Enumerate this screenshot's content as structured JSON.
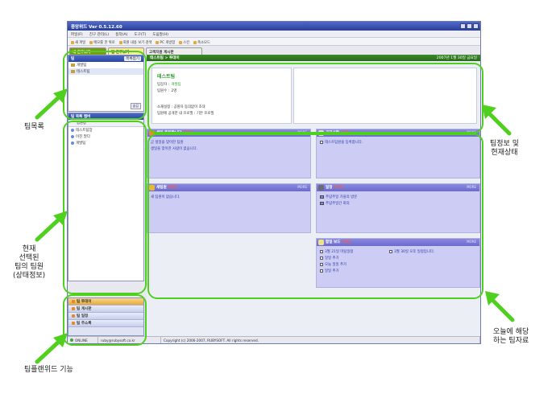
{
  "window": {
    "title": "중앙위드 Ver 0.5.12.60"
  },
  "menu": [
    "파일(F)",
    "친구 관리(L)",
    "동작(A)",
    "도구(T)",
    "도움말(H)"
  ],
  "toolbar": [
    {
      "icon": "document-icon",
      "label": "새 파일"
    },
    {
      "icon": "memo-icon",
      "label": "메모를 한 위로"
    },
    {
      "icon": "search-icon",
      "label": "회원 내용 보기 검색"
    },
    {
      "icon": "monitor-icon",
      "label": "PC 개방함"
    },
    {
      "icon": "menu-icon",
      "label": "스킨"
    },
    {
      "icon": "small-mode-icon",
      "label": "축소모드"
    }
  ],
  "tabs": [
    {
      "label": "내 친구보기"
    },
    {
      "label": "팀 친구보기"
    },
    {
      "label": "고객지원 게시판"
    }
  ],
  "team_panel": {
    "header": "팀",
    "action": "목록접기",
    "teams": [
      {
        "name": "개발팀",
        "selected": false
      },
      {
        "name": "테스트팀",
        "selected": true
      }
    ],
    "small_button": "숨김"
  },
  "member_panel": {
    "header": "팀 목록 멤버",
    "column": "팀원정",
    "members": [
      "테스트팀장",
      "이진 말다",
      "개발팀"
    ]
  },
  "func_list": [
    {
      "label": "팀 투데이",
      "active": true
    },
    {
      "label": "팀 게시판",
      "active": false
    },
    {
      "label": "팀 일정",
      "active": false
    },
    {
      "label": "팀 주소록",
      "active": false
    }
  ],
  "main": {
    "header": "테스트팀 > 투데이",
    "date": "2007년 1월 30일 금요일",
    "team_info": {
      "title": "테스트팀",
      "leader_key": "팀장자 :",
      "leader_value": "개발팀",
      "members_key": "팀원수 :",
      "members_value": "2명",
      "setting_key": "소재설정 :",
      "setting_value": "공원자 동의없이 초대",
      "board_key": "팀원에 공개한 내 프로필 :",
      "board_value": "기본 프로필"
    }
  },
  "cards": {
    "schedule": {
      "title": "생일 축하합니다",
      "count": "(0건)",
      "more": "MORE",
      "lines": [
        "곧 생일을 맞이한 팀원",
        "생일을 맞이한 사람이 없습니다."
      ]
    },
    "guestbook": {
      "title": "공지사항",
      "count": "(1건)",
      "more": "MORE",
      "lines": [
        "테스트팀원을 등록합니다."
      ]
    },
    "newmember": {
      "title": "새팀원",
      "count": "(0건)",
      "more": "MORE",
      "lines": [
        "새 팀원이 없습니다."
      ]
    },
    "album": {
      "title": "일정",
      "count": "(1건)",
      "more": "MORE",
      "lines": [
        "주념주일 가을의 방문",
        "주념주일간 회의"
      ]
    },
    "board": {
      "title": "할일 보드",
      "count": "(5건)",
      "more": "MORE",
      "lines": [
        "3월 21일 미팅일정",
        "3월 30일 오후 일정입니다.",
        "일일 추가",
        "오늘 일일 추가",
        "일일 추가"
      ]
    }
  },
  "statusbar": {
    "status": "ONLINE",
    "email": "ruby@rubysoft.co.kr",
    "copyright": "Copyright (c) 2006-2007, RUBYSOFT. All rights reserved."
  },
  "annotations": {
    "team_list": "팀목록",
    "members": [
      "현재",
      "선택된",
      "팀의 팀원",
      "(상태정보)"
    ],
    "functions": "팀플랜위드 기능",
    "team_status": [
      "팀정보 및",
      "현재상태"
    ],
    "today_data": [
      "오늘에 해당",
      "하는 팀자료"
    ]
  },
  "colors": {
    "highlight": "#50d01e",
    "header_blue": "#2a45a6",
    "header_green": "#2a6a1a",
    "card_bg": "#ccccf4"
  }
}
